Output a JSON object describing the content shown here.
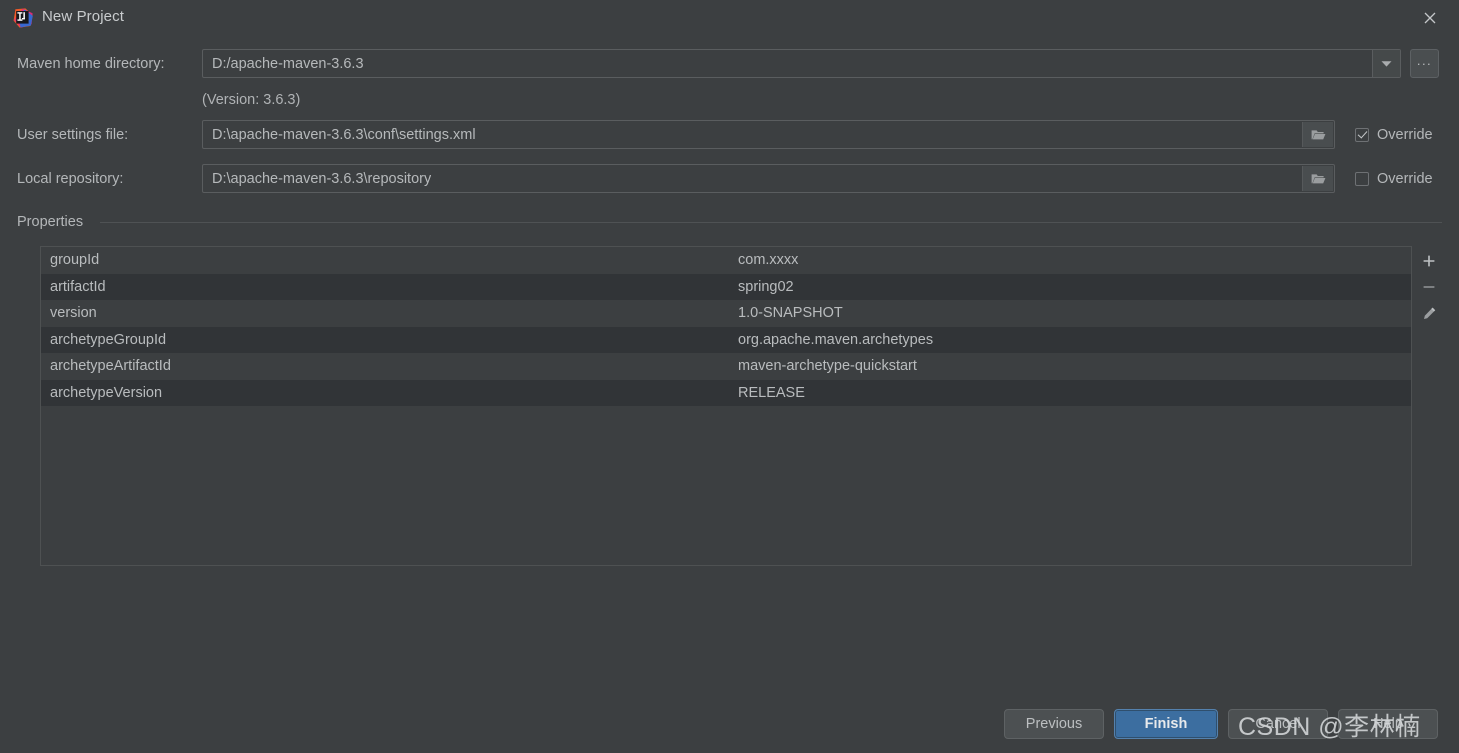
{
  "window": {
    "title": "New Project",
    "app_icon": "intellij-idea-logo",
    "close_icon": "close-icon"
  },
  "form": {
    "maven_home": {
      "label": "Maven home directory:",
      "value": "D:/apache-maven-3.6.3",
      "dropdown_icon": "chevron-down-icon",
      "browse_label": "...",
      "version_note": "(Version: 3.6.3)"
    },
    "user_settings": {
      "label": "User settings file:",
      "value": "D:\\apache-maven-3.6.3\\conf\\settings.xml",
      "folder_icon": "folder-icon",
      "override_label": "Override",
      "override_checked": true
    },
    "local_repository": {
      "label": "Local repository:",
      "value": "D:\\apache-maven-3.6.3\\repository",
      "folder_icon": "folder-icon",
      "override_label": "Override",
      "override_checked": false
    }
  },
  "properties": {
    "group_label": "Properties",
    "rows": [
      {
        "key": "groupId",
        "value": "com.xxxx"
      },
      {
        "key": "artifactId",
        "value": "spring02"
      },
      {
        "key": "version",
        "value": "1.0-SNAPSHOT"
      },
      {
        "key": "archetypeGroupId",
        "value": "org.apache.maven.archetypes"
      },
      {
        "key": "archetypeArtifactId",
        "value": "maven-archetype-quickstart"
      },
      {
        "key": "archetypeVersion",
        "value": "RELEASE"
      }
    ],
    "toolbar": [
      {
        "name": "add-property-button",
        "icon": "plus-icon"
      },
      {
        "name": "remove-property-button",
        "icon": "minus-icon"
      },
      {
        "name": "edit-property-button",
        "icon": "pencil-icon"
      }
    ]
  },
  "footer": {
    "previous_label": "Previous",
    "finish_label": "Finish",
    "cancel_label": "Cancel",
    "help_label": "Help"
  },
  "watermark": {
    "text": "CSDN @李林楠"
  },
  "colors": {
    "background": "#3c3f41",
    "row_alt": "#313437",
    "text": "#b9bcbe",
    "primary_button": "#3c6ea0",
    "border": "#5a5d5f"
  }
}
